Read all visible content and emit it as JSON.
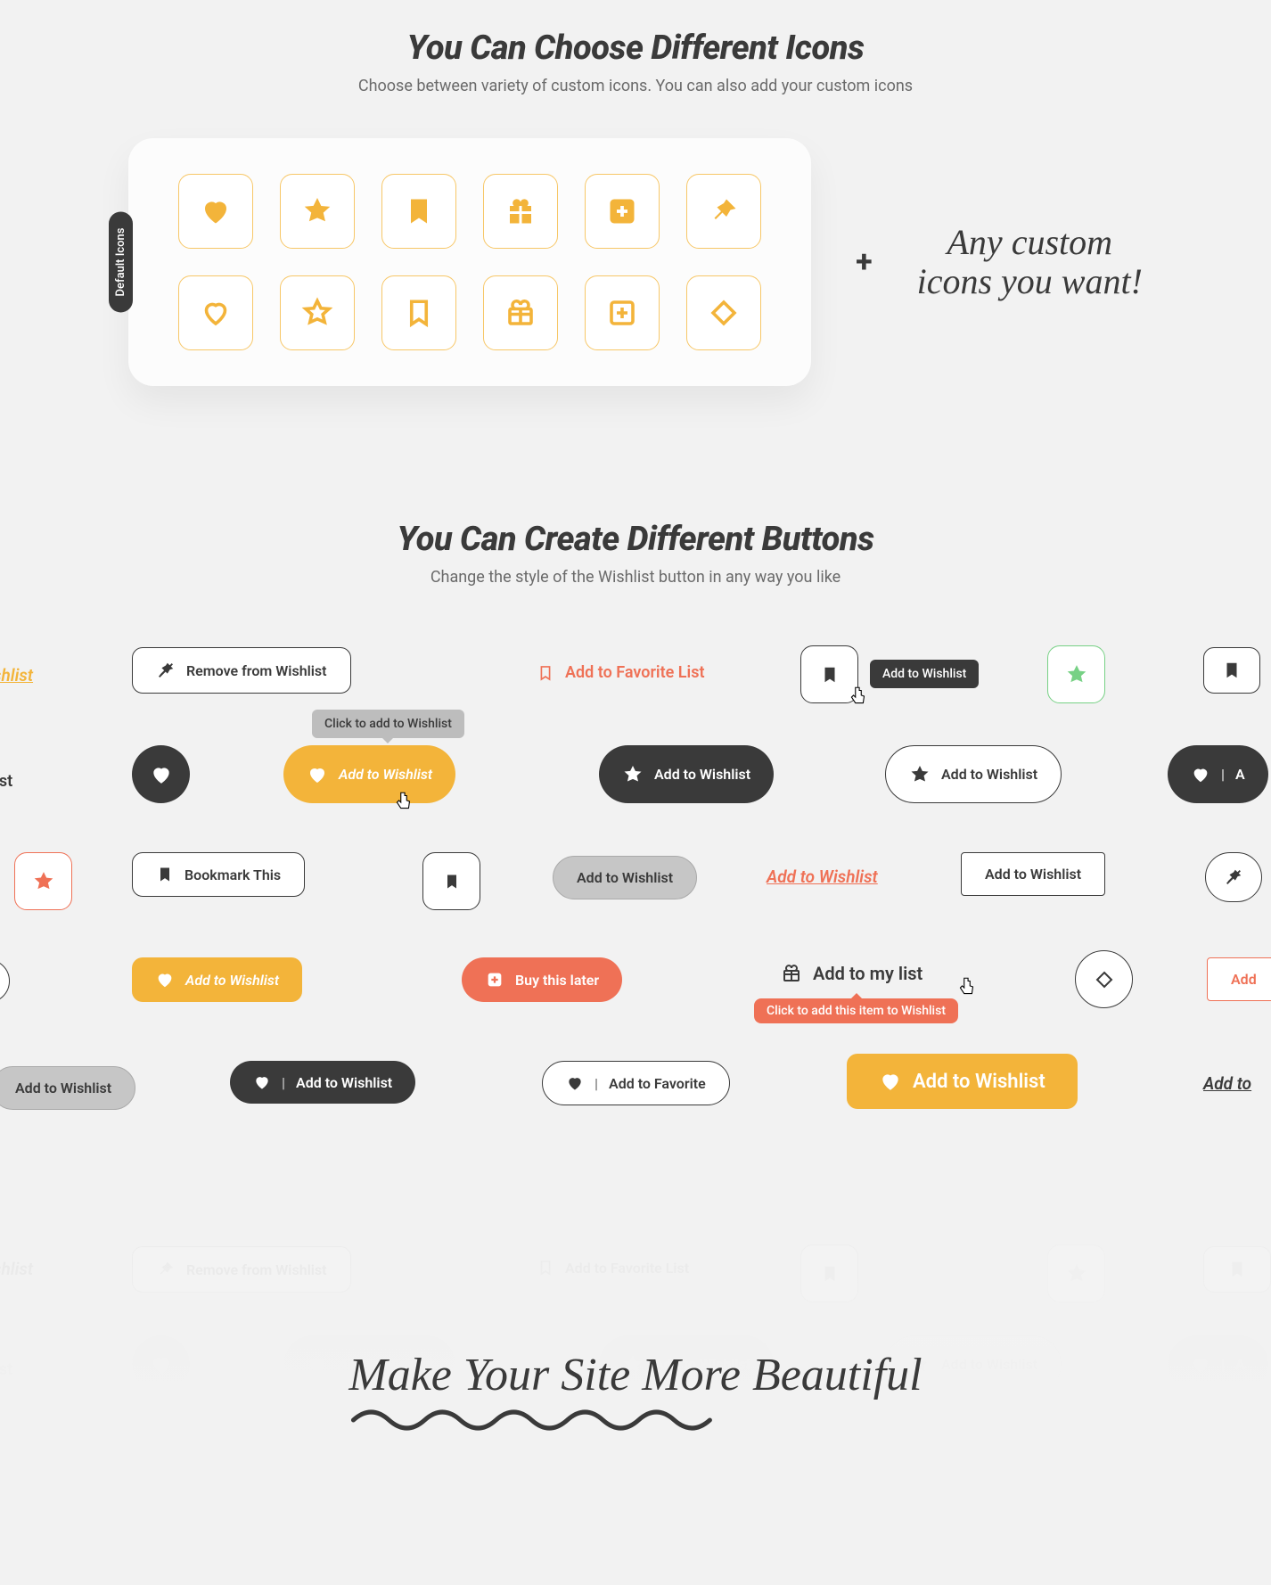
{
  "section1": {
    "title": "You Can Choose Different Icons",
    "subtitle": "Choose between variety of custom icons. You can also add your custom icons",
    "side_label": "Default Icons",
    "plus": "+",
    "script_line1": "Any custom",
    "script_line2": "icons you want!"
  },
  "section2": {
    "title": "You Can Create Different Buttons",
    "subtitle": "Change the style of the Wishlist button in any way you like"
  },
  "buttons": {
    "add_to_wishlist": "Add to Wishlist",
    "remove_from_wishlist": "Remove from Wishlist",
    "add_to_favorite_list": "Add to Favorite List",
    "add_to_favorite": "Add to Favorite",
    "add_to_my_list": "Add to my list",
    "bookmark_this": "Bookmark This",
    "buy_this_later": "Buy this later",
    "add_text": "Add",
    "to_wishlist": "to Wishlist",
    "to_my_list": "to my list",
    "wishlist": "Wishlist",
    "add_to": "Add to",
    "a_letter": "A"
  },
  "tooltips": {
    "add_to_wishlist": "Add to Wishlist",
    "click_to_add": "Click to add to Wishlist",
    "click_this_item": "Click to add this item to Wishlist"
  },
  "banner": {
    "text": "Make Your Site More Beautiful"
  }
}
